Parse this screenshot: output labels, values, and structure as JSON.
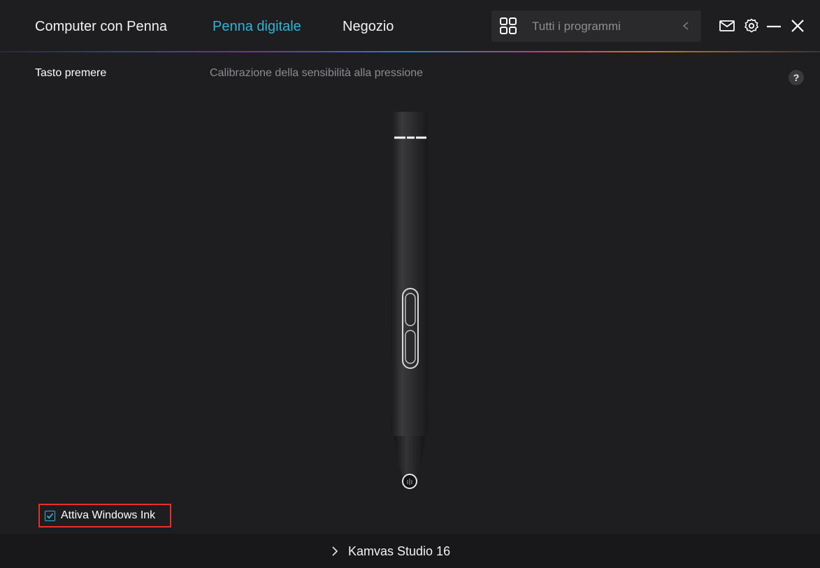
{
  "nav": {
    "tabs": [
      {
        "label": "Computer con Penna",
        "active": false
      },
      {
        "label": "Penna digitale",
        "active": true
      },
      {
        "label": "Negozio",
        "active": false
      }
    ],
    "programs_placeholder": "Tutti i programmi"
  },
  "window_icons": [
    "mail-icon",
    "gear-icon",
    "minimize-icon",
    "close-icon"
  ],
  "subheader": {
    "left": "Tasto premere",
    "middle": "Calibrazione della sensibilità alla pressione",
    "help": "?"
  },
  "windows_ink": {
    "label": "Attiva Windows Ink",
    "checked": true
  },
  "footer": {
    "device": "Kamvas Studio 16"
  },
  "colors": {
    "accent": "#2fb3d9",
    "background": "#1e1e20",
    "highlight_border": "#e8302a"
  }
}
